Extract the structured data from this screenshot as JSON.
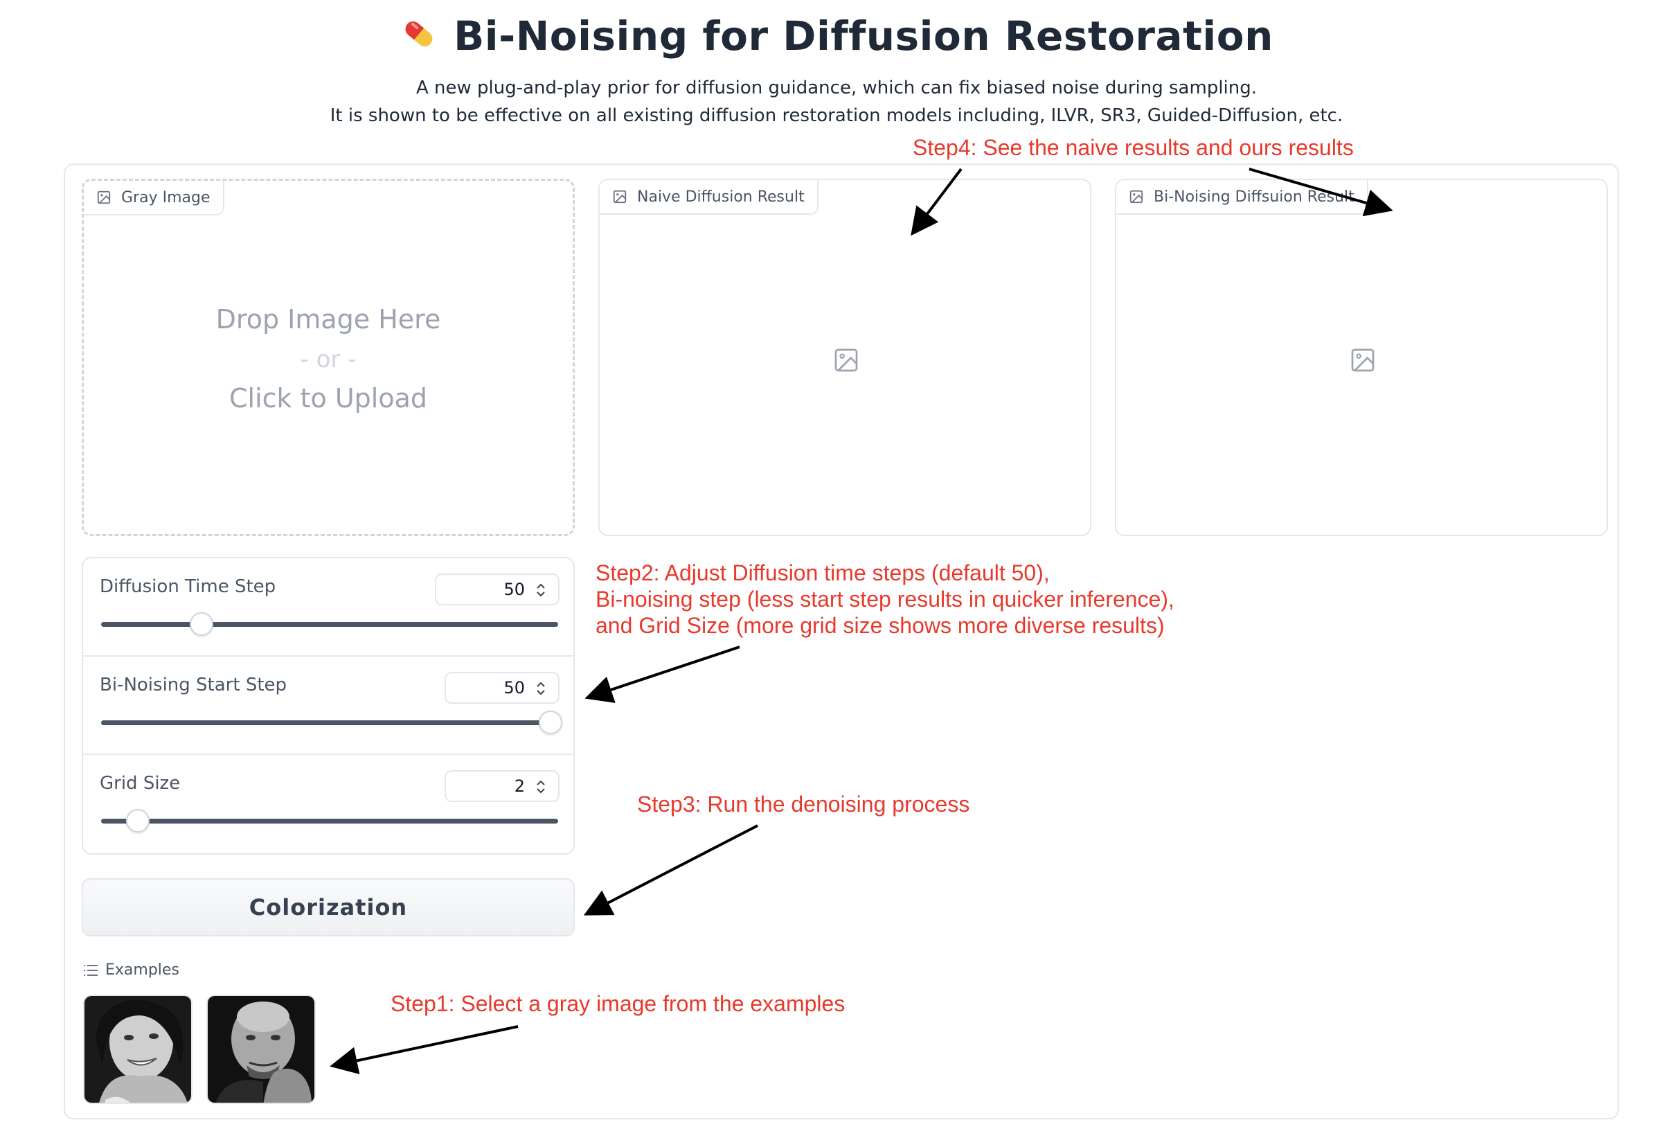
{
  "header": {
    "title": "Bi-Noising for Diffusion Restoration",
    "subtitle_line1": "A new plug-and-play prior for diffusion guidance, which can fix biased noise during sampling.",
    "subtitle_line2": "It is shown to be effective on all existing diffusion restoration models including, ILVR, SR3, Guided-Diffusion, etc."
  },
  "panels": {
    "input": {
      "label": "Gray Image",
      "drop_text": "Drop Image Here",
      "or_text": "- or -",
      "upload_text": "Click to Upload"
    },
    "naive": {
      "label": "Naive Diffusion Result"
    },
    "bi_noising": {
      "label": "Bi-Noising Diffsuion Result"
    }
  },
  "sliders": [
    {
      "label": "Diffusion Time Step",
      "value": "50",
      "level": 0.22
    },
    {
      "label": "Bi-Noising Start Step",
      "value": "50",
      "level": 1.0
    },
    {
      "label": "Grid Size",
      "value": "2",
      "level": 0.08
    }
  ],
  "button": {
    "label": "Colorization"
  },
  "examples": {
    "label": "Examples",
    "count": 2
  },
  "annotations": {
    "step1": "Step1: Select a gray image from the examples",
    "step2_line1": "Step2: Adjust Diffusion time steps (default 50),",
    "step2_line2": "Bi-noising step (less start step results in quicker inference),",
    "step2_line3": "and Grid Size (more grid size shows more diverse results)",
    "step3": "Step3: Run the denoising process",
    "step4": "Step4: See the naive results and ours results"
  },
  "colors": {
    "annotation": "#e8392b",
    "border": "#e5e7eb",
    "track": "#4b5563"
  }
}
